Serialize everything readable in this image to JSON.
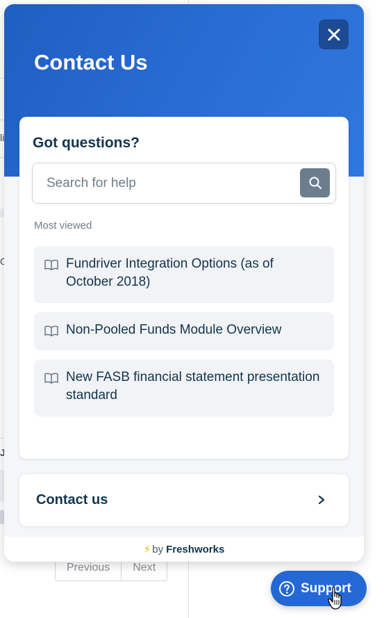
{
  "widget": {
    "title": "Contact Us",
    "close_icon": "close-icon",
    "search_card": {
      "title": "Got questions?",
      "search_placeholder": "Search for help",
      "search_icon": "search-icon",
      "section_label": "Most viewed",
      "articles": [
        {
          "title": "Fundriver Integration Options (as of October 2018)",
          "icon": "book-icon"
        },
        {
          "title": "Non-Pooled Funds Module Overview",
          "icon": "book-icon"
        },
        {
          "title": "New FASB financial statement presentation standard",
          "icon": "book-icon"
        }
      ]
    },
    "contact": {
      "label": "Contact us",
      "icon": "chevron-right-icon"
    },
    "footer": {
      "prefix": "by",
      "brand": "Freshworks",
      "icon": "lightning-icon"
    }
  },
  "launcher": {
    "label": "Support",
    "icon": "help-circle-icon"
  },
  "background": {
    "pagination": {
      "previous": "Previous",
      "next": "Next"
    },
    "fragments": [
      "li",
      "G,",
      "Ji"
    ]
  },
  "colors": {
    "header_blue": "#2a6ed6",
    "close_button": "#1c4a93",
    "text_dark": "#12344d",
    "search_button": "#6c7d8e",
    "launcher_blue": "#2468d5"
  }
}
